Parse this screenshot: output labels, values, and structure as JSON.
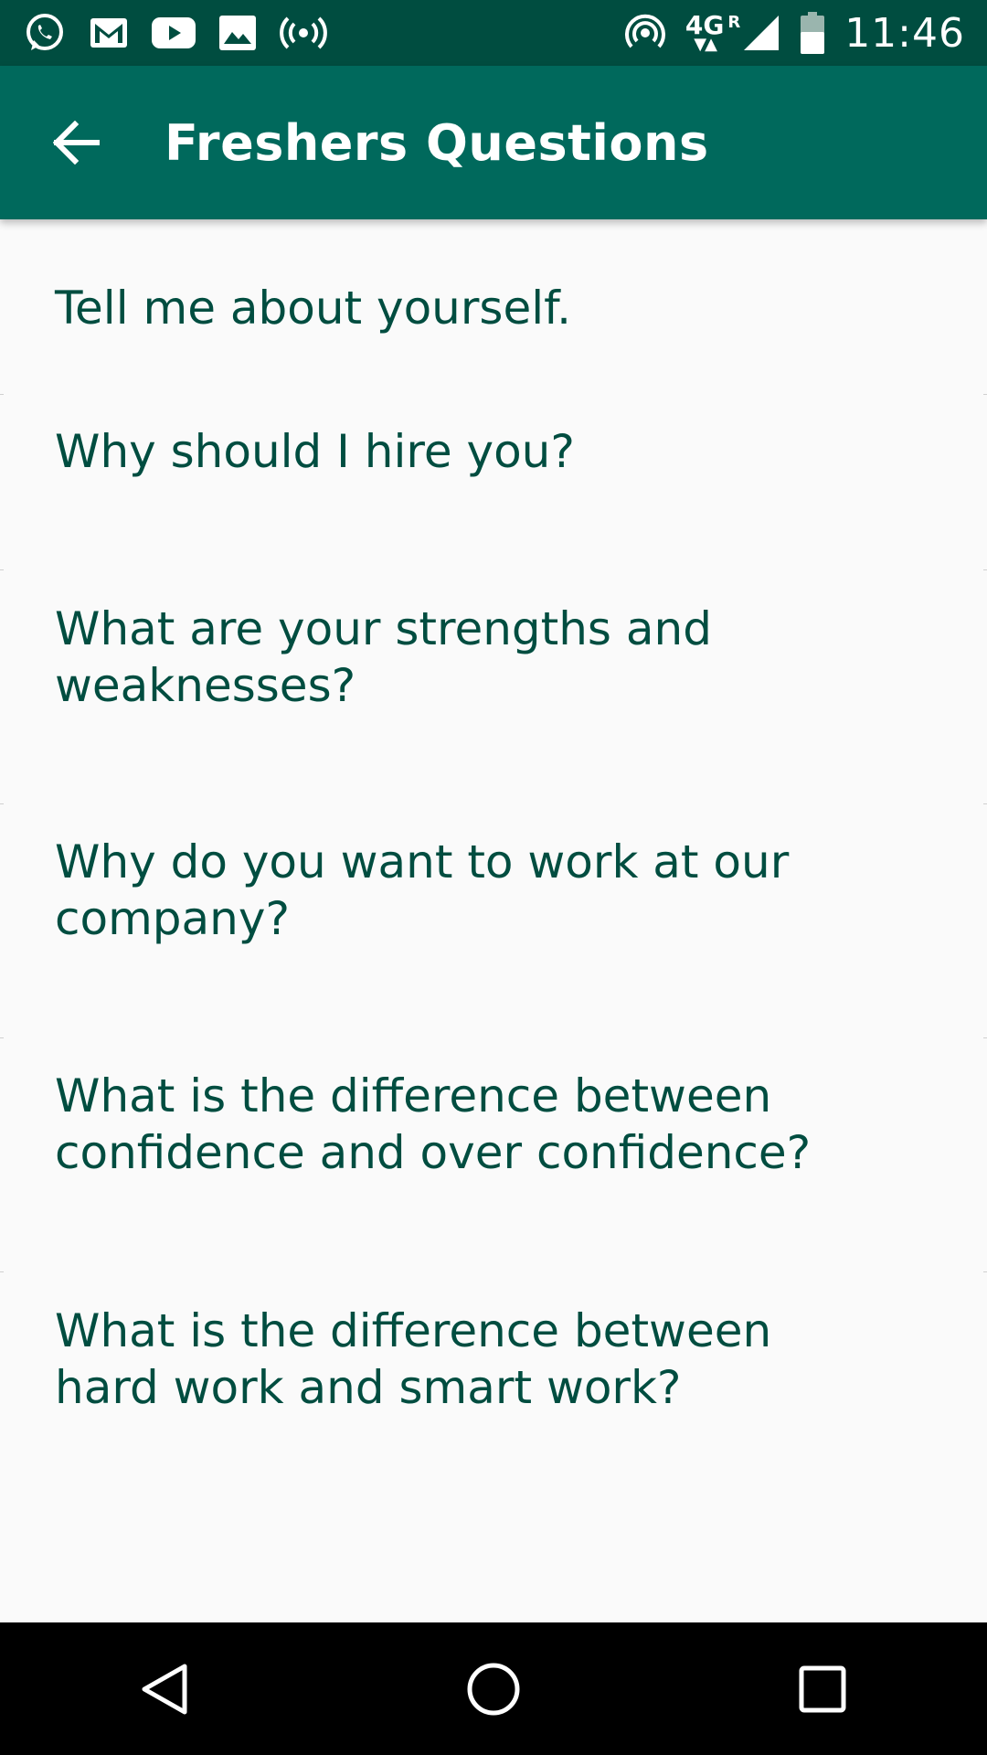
{
  "status_bar": {
    "left_icons": [
      "whatsapp-icon",
      "gmail-icon",
      "youtube-icon",
      "image-icon",
      "hotspot-broadcast-icon"
    ],
    "network_label": "4G",
    "roaming_label": "R",
    "time": "11:46"
  },
  "app_bar": {
    "title": "Freshers Questions",
    "back_icon": "arrow-back-icon"
  },
  "questions": [
    "Tell me about yourself.",
    "Why should I hire you?",
    "What are your strengths and weaknesses?",
    "Why do you want to work at our company?",
    "What is the difference between confidence and over confidence?",
    "What is the difference between hard work and smart work?"
  ],
  "nav_bar": {
    "buttons": [
      "back-triangle-icon",
      "home-circle-icon",
      "recents-square-icon"
    ]
  },
  "colors": {
    "status_bar": "#004d40",
    "app_bar": "#00695c",
    "list_text": "#004d40",
    "background": "#fafafa",
    "nav_bar": "#000000"
  }
}
